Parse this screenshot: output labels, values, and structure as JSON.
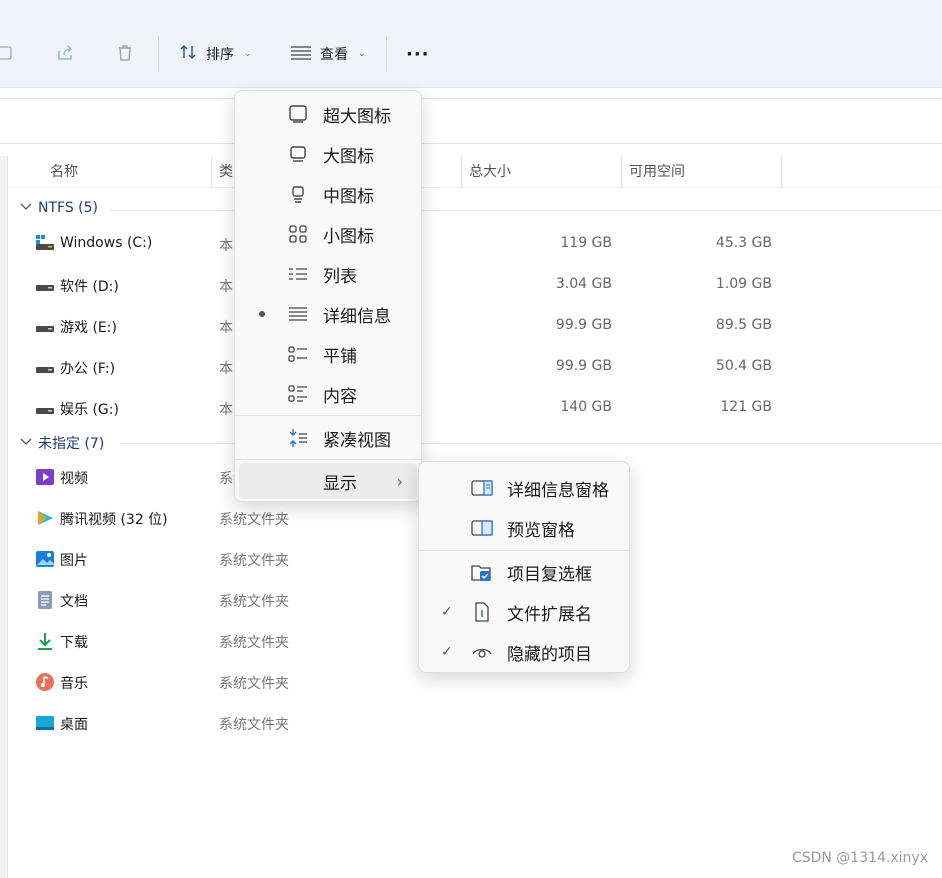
{
  "toolbar": {
    "sort_label": "排序",
    "view_label": "查看",
    "more_label": "···"
  },
  "columns": {
    "name": "名称",
    "type": "类",
    "total": "总大小",
    "free": "可用空间"
  },
  "groups": {
    "ntfs": "NTFS (5)",
    "unspecified": "未指定 (7)"
  },
  "drives": [
    {
      "name": "Windows (C:)",
      "type": "本",
      "total": "119 GB",
      "free": "45.3 GB"
    },
    {
      "name": "软件 (D:)",
      "type": "本",
      "total": "3.04 GB",
      "free": "1.09 GB"
    },
    {
      "name": "游戏 (E:)",
      "type": "本",
      "total": "99.9 GB",
      "free": "89.5 GB"
    },
    {
      "name": "办公 (F:)",
      "type": "本",
      "total": "99.9 GB",
      "free": "50.4 GB"
    },
    {
      "name": "娱乐 (G:)",
      "type": "本",
      "total": "140 GB",
      "free": "121 GB"
    }
  ],
  "folders": [
    {
      "name": "视频",
      "type": "系统文件夹"
    },
    {
      "name": "腾讯视频 (32 位)",
      "type": "系统文件夹"
    },
    {
      "name": "图片",
      "type": "系统文件夹"
    },
    {
      "name": "文档",
      "type": "系统文件夹"
    },
    {
      "name": "下载",
      "type": "系统文件夹"
    },
    {
      "name": "音乐",
      "type": "系统文件夹"
    },
    {
      "name": "桌面",
      "type": "系统文件夹"
    }
  ],
  "view_menu": {
    "items": [
      {
        "label": "超大图标"
      },
      {
        "label": "大图标"
      },
      {
        "label": "中图标"
      },
      {
        "label": "小图标"
      },
      {
        "label": "列表"
      },
      {
        "label": "详细信息",
        "selected": true
      },
      {
        "label": "平铺"
      },
      {
        "label": "内容"
      },
      {
        "label": "紧凑视图"
      },
      {
        "label": "显示"
      }
    ]
  },
  "show_menu": {
    "items": [
      {
        "label": "详细信息窗格"
      },
      {
        "label": "预览窗格"
      },
      {
        "label": "项目复选框"
      },
      {
        "label": "文件扩展名",
        "checked": true
      },
      {
        "label": "隐藏的项目",
        "checked": true
      }
    ]
  },
  "watermark": "CSDN @1314.xinyx",
  "colors": {
    "toolbar_bg": "#eef4f9",
    "group_text": "#1e3c72",
    "menu_bg": "#f9f9f9",
    "accent": "#2a73c5"
  }
}
